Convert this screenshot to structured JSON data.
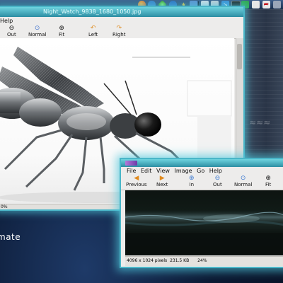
{
  "top_panel": {
    "icons": [
      "firefox-icon",
      "bird-icon",
      "gem-icon",
      "clock-icon",
      "star-icon",
      "monitor-icon",
      "computer-icon",
      "folder-icon",
      "download-icon",
      "terminal-icon",
      "sheet-icon",
      "files-icon",
      "pdf-icon",
      "menu-icon"
    ]
  },
  "desktop": {
    "caption": "mate"
  },
  "window1": {
    "title": "Night_Watch_9838_1680_1050.jpg",
    "menu": [
      "Help"
    ],
    "toolbar": {
      "out": "Out",
      "normal": "Normal",
      "fit": "Fit",
      "left": "Left",
      "right": "Right"
    },
    "status_zoom": "0%"
  },
  "window2": {
    "menu": [
      "File",
      "Edit",
      "View",
      "Image",
      "Go",
      "Help"
    ],
    "toolbar": {
      "previous": "Previous",
      "next": "Next",
      "in": "In",
      "out": "Out",
      "normal": "Normal",
      "fit": "Fit"
    },
    "status": {
      "dimensions": "4096 x 1024 pixels",
      "size": "231.5 KB",
      "zoom": "24%"
    }
  },
  "colors": {
    "glow": "#4ab6c8",
    "titlebar": "#2d8ea3",
    "panel": "#1a2f4d"
  }
}
